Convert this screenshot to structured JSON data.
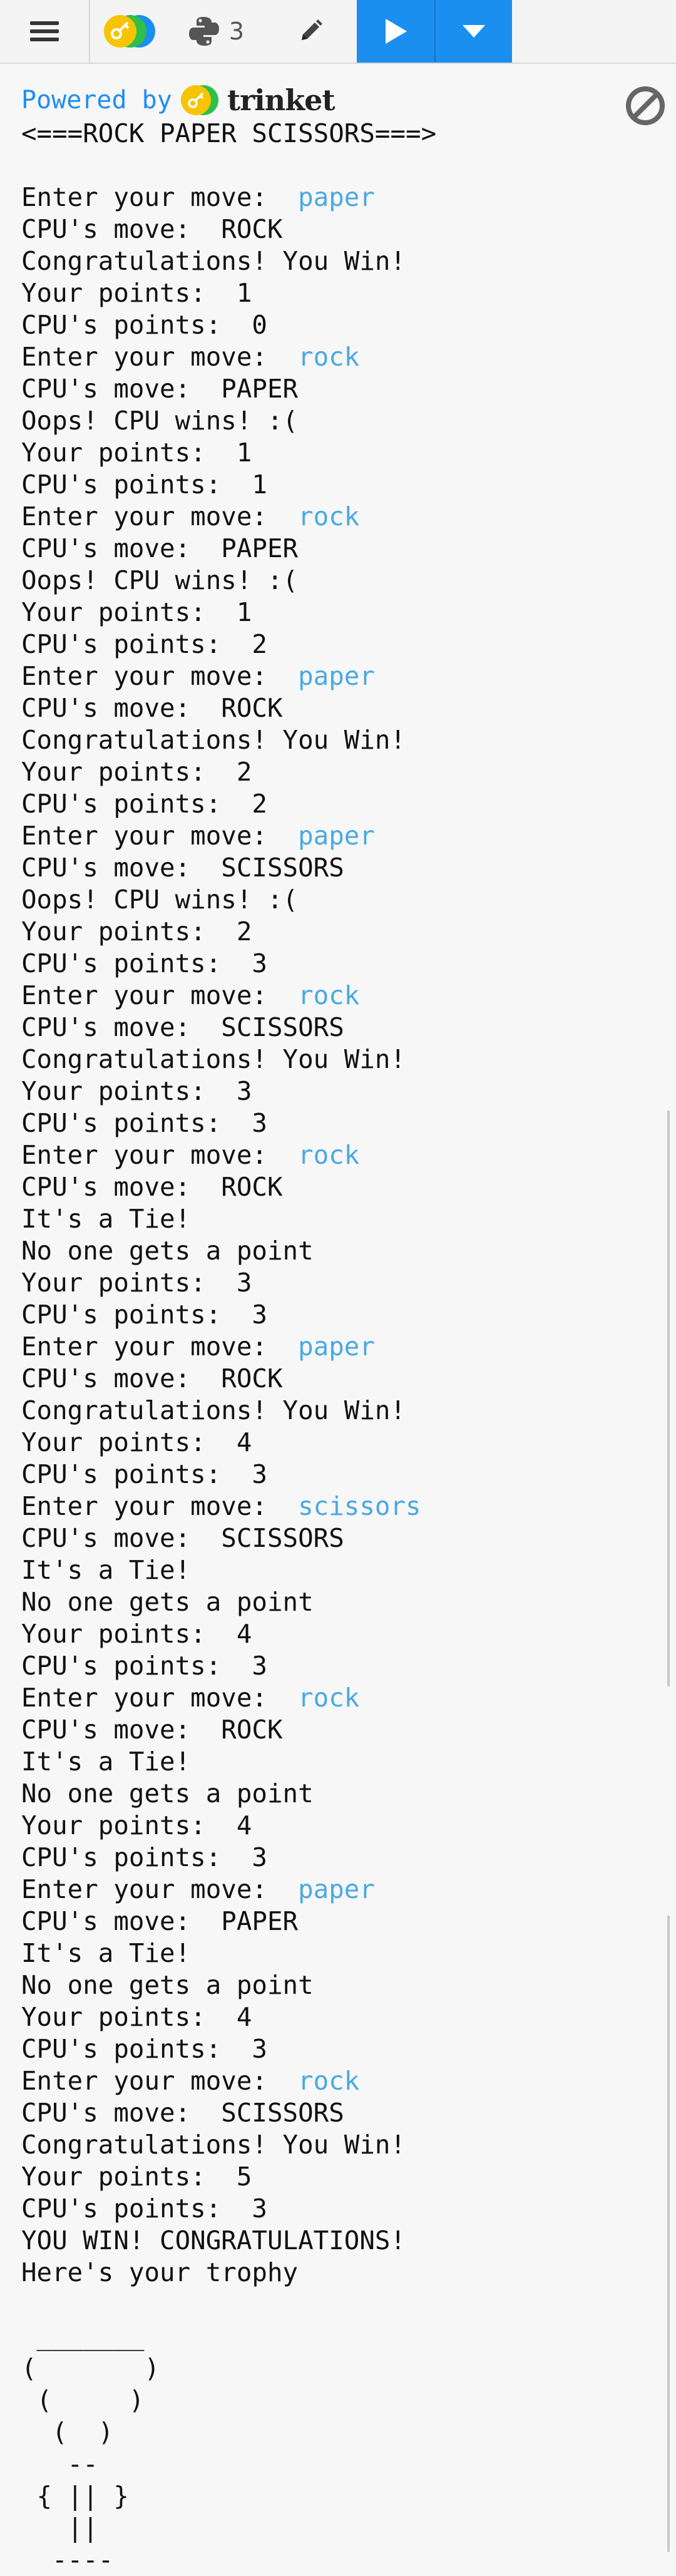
{
  "toolbar": {
    "menu_icon": "hamburger-menu-icon",
    "logo_icon": "trinket-logo-icon",
    "python_icon": "python-icon",
    "python_version": "3",
    "pencil_icon": "pencil-edit-icon",
    "run_icon": "play-icon",
    "dropdown_icon": "caret-down-icon",
    "accent": "#1b8ff0"
  },
  "banner": {
    "powered_by": "Powered by",
    "brand": "trinket",
    "clear_icon": "no-entry-icon"
  },
  "console": {
    "input_color": "#4aa9e3",
    "lines": [
      {
        "text": "<===ROCK PAPER SCISSORS===>",
        "input": ""
      },
      {
        "text": "",
        "input": ""
      },
      {
        "text": "Enter your move:  ",
        "input": "paper"
      },
      {
        "text": "CPU's move:  ROCK",
        "input": ""
      },
      {
        "text": "Congratulations! You Win!",
        "input": ""
      },
      {
        "text": "Your points:  1",
        "input": ""
      },
      {
        "text": "CPU's points:  0",
        "input": ""
      },
      {
        "text": "Enter your move:  ",
        "input": "rock"
      },
      {
        "text": "CPU's move:  PAPER",
        "input": ""
      },
      {
        "text": "Oops! CPU wins! :(",
        "input": ""
      },
      {
        "text": "Your points:  1",
        "input": ""
      },
      {
        "text": "CPU's points:  1",
        "input": ""
      },
      {
        "text": "Enter your move:  ",
        "input": "rock"
      },
      {
        "text": "CPU's move:  PAPER",
        "input": ""
      },
      {
        "text": "Oops! CPU wins! :(",
        "input": ""
      },
      {
        "text": "Your points:  1",
        "input": ""
      },
      {
        "text": "CPU's points:  2",
        "input": ""
      },
      {
        "text": "Enter your move:  ",
        "input": "paper"
      },
      {
        "text": "CPU's move:  ROCK",
        "input": ""
      },
      {
        "text": "Congratulations! You Win!",
        "input": ""
      },
      {
        "text": "Your points:  2",
        "input": ""
      },
      {
        "text": "CPU's points:  2",
        "input": ""
      },
      {
        "text": "Enter your move:  ",
        "input": "paper"
      },
      {
        "text": "CPU's move:  SCISSORS",
        "input": ""
      },
      {
        "text": "Oops! CPU wins! :(",
        "input": ""
      },
      {
        "text": "Your points:  2",
        "input": ""
      },
      {
        "text": "CPU's points:  3",
        "input": ""
      },
      {
        "text": "Enter your move:  ",
        "input": "rock"
      },
      {
        "text": "CPU's move:  SCISSORS",
        "input": ""
      },
      {
        "text": "Congratulations! You Win!",
        "input": ""
      },
      {
        "text": "Your points:  3",
        "input": ""
      },
      {
        "text": "CPU's points:  3",
        "input": ""
      },
      {
        "text": "Enter your move:  ",
        "input": "rock"
      },
      {
        "text": "CPU's move:  ROCK",
        "input": ""
      },
      {
        "text": "It's a Tie!",
        "input": ""
      },
      {
        "text": "No one gets a point",
        "input": ""
      },
      {
        "text": "Your points:  3",
        "input": ""
      },
      {
        "text": "CPU's points:  3",
        "input": ""
      },
      {
        "text": "Enter your move:  ",
        "input": "paper"
      },
      {
        "text": "CPU's move:  ROCK",
        "input": ""
      },
      {
        "text": "Congratulations! You Win!",
        "input": ""
      },
      {
        "text": "Your points:  4",
        "input": ""
      },
      {
        "text": "CPU's points:  3",
        "input": ""
      },
      {
        "text": "Enter your move:  ",
        "input": "scissors"
      },
      {
        "text": "CPU's move:  SCISSORS",
        "input": ""
      },
      {
        "text": "It's a Tie!",
        "input": ""
      },
      {
        "text": "No one gets a point",
        "input": ""
      },
      {
        "text": "Your points:  4",
        "input": ""
      },
      {
        "text": "CPU's points:  3",
        "input": ""
      },
      {
        "text": "Enter your move:  ",
        "input": "rock"
      },
      {
        "text": "CPU's move:  ROCK",
        "input": ""
      },
      {
        "text": "It's a Tie!",
        "input": ""
      },
      {
        "text": "No one gets a point",
        "input": ""
      },
      {
        "text": "Your points:  4",
        "input": ""
      },
      {
        "text": "CPU's points:  3",
        "input": ""
      },
      {
        "text": "Enter your move:  ",
        "input": "paper"
      },
      {
        "text": "CPU's move:  PAPER",
        "input": ""
      },
      {
        "text": "It's a Tie!",
        "input": ""
      },
      {
        "text": "No one gets a point",
        "input": ""
      },
      {
        "text": "Your points:  4",
        "input": ""
      },
      {
        "text": "CPU's points:  3",
        "input": ""
      },
      {
        "text": "Enter your move:  ",
        "input": "rock"
      },
      {
        "text": "CPU's move:  SCISSORS",
        "input": ""
      },
      {
        "text": "Congratulations! You Win!",
        "input": ""
      },
      {
        "text": "Your points:  5",
        "input": ""
      },
      {
        "text": "CPU's points:  3",
        "input": ""
      },
      {
        "text": "YOU WIN! CONGRATULATIONS!",
        "input": ""
      },
      {
        "text": "Here's your trophy",
        "input": ""
      },
      {
        "text": "",
        "input": ""
      },
      {
        "text": " _______",
        "input": ""
      },
      {
        "text": "(       )",
        "input": ""
      },
      {
        "text": " (     )",
        "input": ""
      },
      {
        "text": "  (  )",
        "input": ""
      },
      {
        "text": "   --",
        "input": ""
      },
      {
        "text": " { || }",
        "input": ""
      },
      {
        "text": "   ||",
        "input": ""
      },
      {
        "text": "  ----",
        "input": ""
      }
    ]
  }
}
